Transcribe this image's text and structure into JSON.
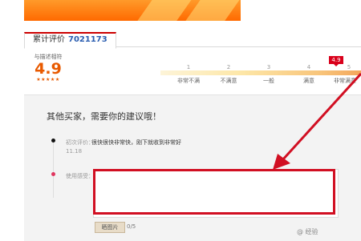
{
  "reviews_tab": {
    "label": "累计评价",
    "count": "7021173"
  },
  "score": {
    "label": "与描述相符",
    "value": "4.9",
    "stars": "★★★★★"
  },
  "rating_scale": {
    "ticks": [
      "1",
      "2",
      "3",
      "4",
      "5"
    ],
    "labels": [
      "非常不满",
      "不满意",
      "一般",
      "满意",
      "非常满意"
    ],
    "marker": "4.9"
  },
  "panel": {
    "title": "其他买家，需要你的建议哦！",
    "first_review_label": "初次评价：",
    "first_review_text": "很快很快非常快，刚下就收到非常好",
    "first_review_date": "11.18",
    "usage_label": "使用感受："
  },
  "upload": {
    "button_label": "晒图片",
    "counter": "0/5"
  },
  "watermark": "@ 经验"
}
